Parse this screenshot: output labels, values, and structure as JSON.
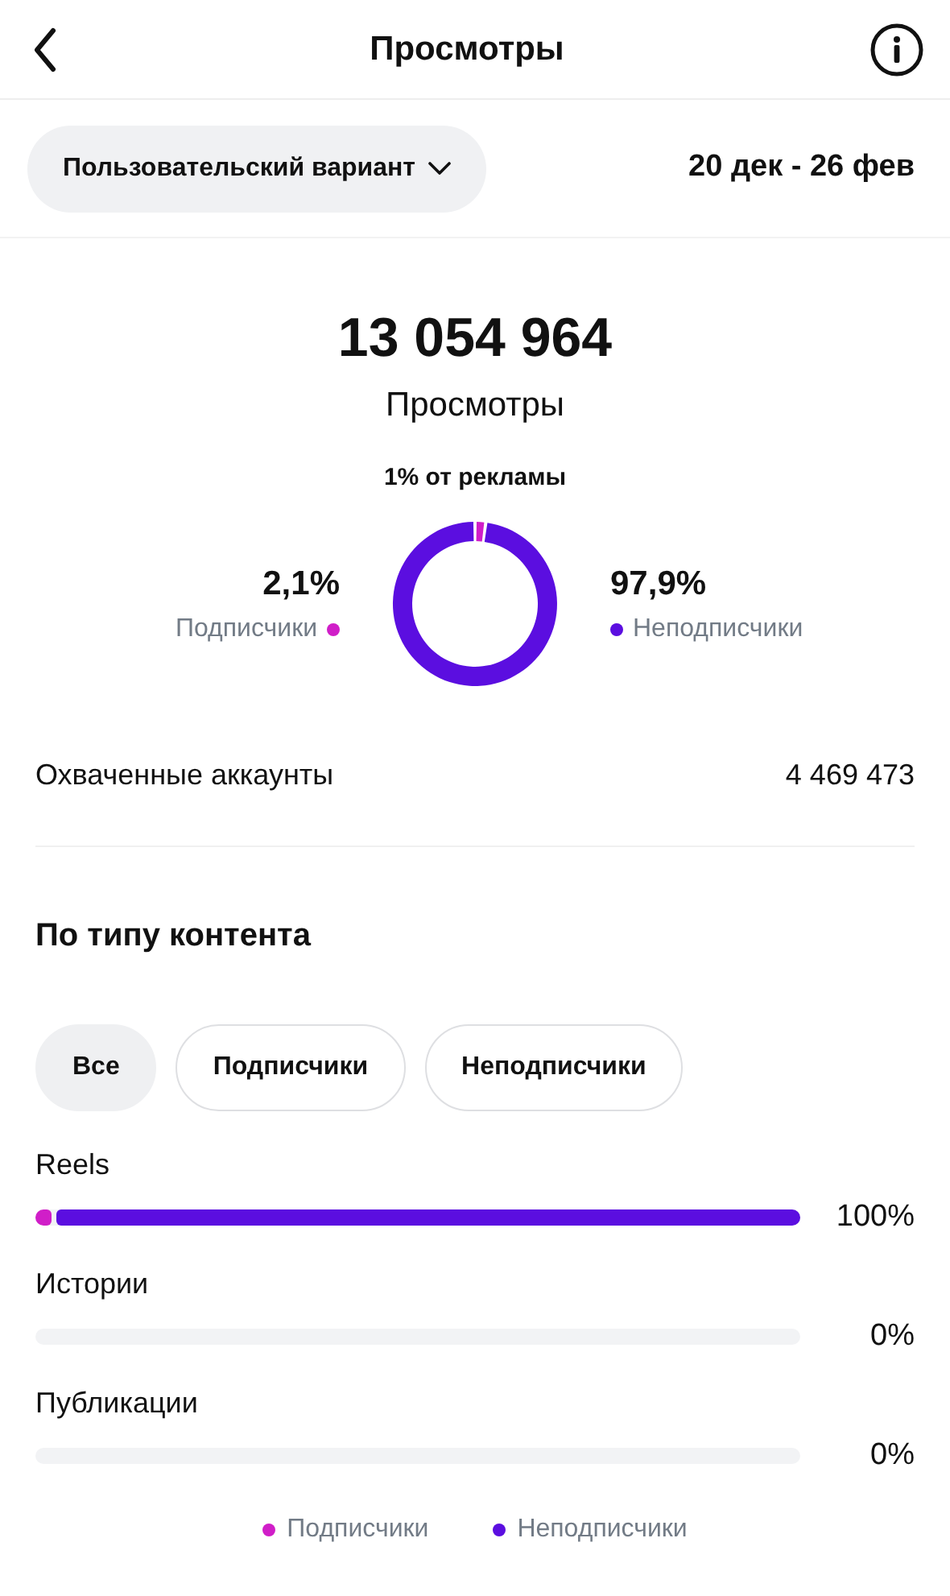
{
  "header": {
    "title": "Просмотры"
  },
  "period": {
    "dropdown": "Пользовательский вариант",
    "range": "20 дек - 26 фев"
  },
  "summary": {
    "total": "13 054 964",
    "label": "Просмотры",
    "ads_note": "1% от рекламы"
  },
  "audience": [
    {
      "value": "2,1%",
      "color": "#d01ec8"
    },
    {
      "value": "97,9%",
      "color": "#5b0ee0"
    }
  ],
  "chart_data": {
    "type": "donut",
    "categories": [
      "Подписчики",
      "Неподписчики"
    ],
    "series": [
      {
        "values": [
          2.1,
          97.9
        ]
      }
    ]
  },
  "reach": {
    "label": "Охваченные аккаунты",
    "value": "4 469 473"
  },
  "content_section": {
    "title": "По типу контента",
    "filters": [
      {
        "label": "Все",
        "selected": true
      },
      {
        "label": "Подписчики",
        "selected": false
      },
      {
        "label": "Неподписчики",
        "selected": false
      }
    ],
    "rows": [
      {
        "label": "Reels",
        "percent": "100%",
        "segments": [
          {
            "level": 0.021
          },
          {
            "level": 0.979
          }
        ]
      },
      {
        "label": "Истории",
        "percent": "0%"
      },
      {
        "label": "Публикации",
        "percent": "0%"
      }
    ]
  },
  "legend": [
    {
      "label": "Подписчики",
      "color": "#d01ec8"
    },
    {
      "label": "Неподписчики",
      "color": "#5b0ee0"
    }
  ]
}
